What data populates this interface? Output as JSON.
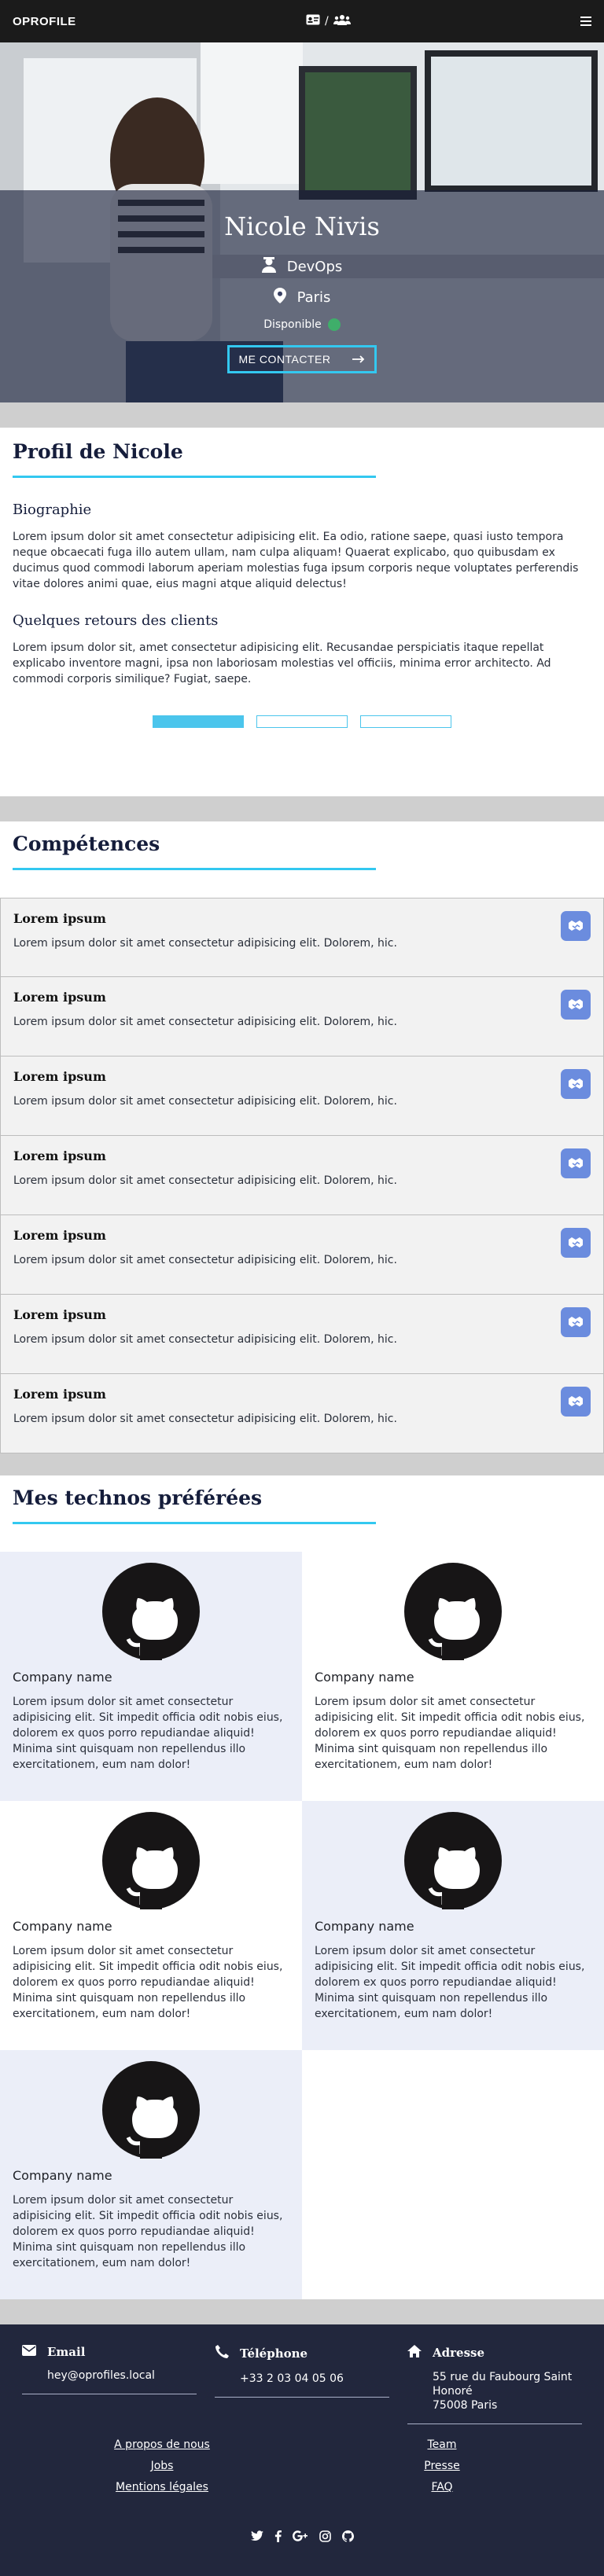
{
  "nav": {
    "brand": "OPROFILE",
    "separator": "/",
    "icons": [
      "id-card-icon",
      "users-icon"
    ],
    "menu_icon": "hamburger-menu-icon"
  },
  "hero": {
    "name": "Nicole Nivis",
    "role": "DevOps",
    "city": "Paris",
    "availability": "Disponible",
    "availability_color": "#3fae6a",
    "cta": "ME CONTACTER",
    "cta_border": "#33c8f0"
  },
  "profile": {
    "title": "Profil de Nicole",
    "bio_title": "Biographie",
    "bio": "Lorem ipsum dolor sit amet consectetur adipisicing elit. Ea odio, ratione saepe, quasi iusto tempora neque obcaecati fuga illo autem ullam, nam culpa aliquam! Quaerat explicabo, quo quibusdam ex ducimus quod commodi laborum aperiam molestias fuga ipsum corporis neque voluptates perferendis vitae dolores animi quae, eius magni atque aliquid delectus!",
    "reviews_title": "Quelques retours des clients",
    "review": "Lorem ipsum dolor sit, amet consectetur adipisicing elit. Recusandae perspiciatis itaque repellat explicabo inventore magni, ipsa non laboriosam molestias vel officiis, minima error architecto. Ad commodi corporis similique? Fugiat, saepe.",
    "carousel_active_index": 0,
    "carousel_count": 3
  },
  "skills": {
    "title": "Compétences",
    "items": [
      {
        "name": "Lorem ipsum",
        "text": "Lorem ipsum dolor sit amet consectetur adipisicing elit. Dolorem, hic."
      },
      {
        "name": "Lorem ipsum",
        "text": "Lorem ipsum dolor sit amet consectetur adipisicing elit. Dolorem, hic."
      },
      {
        "name": "Lorem ipsum",
        "text": "Lorem ipsum dolor sit amet consectetur adipisicing elit. Dolorem, hic."
      },
      {
        "name": "Lorem ipsum",
        "text": "Lorem ipsum dolor sit amet consectetur adipisicing elit. Dolorem, hic."
      },
      {
        "name": "Lorem ipsum",
        "text": "Lorem ipsum dolor sit amet consectetur adipisicing elit. Dolorem, hic."
      },
      {
        "name": "Lorem ipsum",
        "text": "Lorem ipsum dolor sit amet consectetur adipisicing elit. Dolorem, hic."
      },
      {
        "name": "Lorem ipsum",
        "text": "Lorem ipsum dolor sit amet consectetur adipisicing elit. Dolorem, hic."
      }
    ],
    "button_icon": "handshake-icon",
    "button_color": "#6b8cde"
  },
  "technos": {
    "title": "Mes technos préférées",
    "logo_icon": "github-icon",
    "items": [
      {
        "company": "Company name",
        "text": "Lorem ipsum dolor sit amet consectetur adipisicing elit. Sit impedit officia odit nobis eius, dolorem ex quos porro repudiandae aliquid! Minima sint quisquam non repellendus illo exercitationem, eum nam dolor!"
      },
      {
        "company": "Company name",
        "text": "Lorem ipsum dolor sit amet consectetur adipisicing elit. Sit impedit officia odit nobis eius, dolorem ex quos porro repudiandae aliquid! Minima sint quisquam non repellendus illo exercitationem, eum nam dolor!"
      },
      {
        "company": "Company name",
        "text": "Lorem ipsum dolor sit amet consectetur adipisicing elit. Sit impedit officia odit nobis eius, dolorem ex quos porro repudiandae aliquid! Minima sint quisquam non repellendus illo exercitationem, eum nam dolor!"
      },
      {
        "company": "Company name",
        "text": "Lorem ipsum dolor sit amet consectetur adipisicing elit. Sit impedit officia odit nobis eius, dolorem ex quos porro repudiandae aliquid! Minima sint quisquam non repellendus illo exercitationem, eum nam dolor!"
      },
      {
        "company": "Company name",
        "text": "Lorem ipsum dolor sit amet consectetur adipisicing elit. Sit impedit officia odit nobis eius, dolorem ex quos porro repudiandae aliquid! Minima sint quisquam non repellendus illo exercitationem, eum nam dolor!"
      }
    ]
  },
  "footer": {
    "email": {
      "label": "Email",
      "value": "hey@oprofiles.local",
      "icon": "envelope-icon"
    },
    "phone": {
      "label": "Téléphone",
      "value": "+33 2 03 04 05 06",
      "icon": "phone-icon"
    },
    "address": {
      "label": "Adresse",
      "line1": "55 rue du Faubourg Saint",
      "line2": "Honoré",
      "line3": "75008 Paris",
      "icon": "home-icon"
    },
    "links_left": [
      "A propos de nous",
      "Jobs",
      "Mentions légales"
    ],
    "links_right": [
      "Team",
      "Presse",
      "FAQ"
    ],
    "social": [
      "twitter-icon",
      "facebook-icon",
      "google-plus-icon",
      "instagram-icon",
      "github-icon"
    ],
    "background": "#22273d"
  }
}
